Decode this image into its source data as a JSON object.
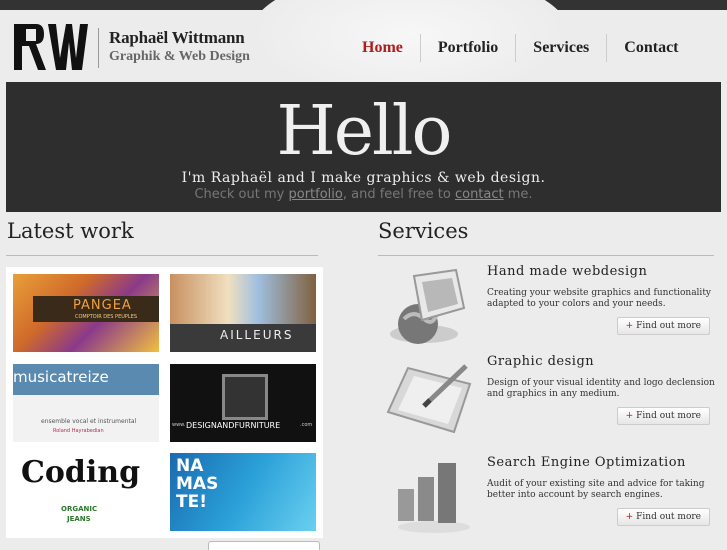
{
  "brand": {
    "name": "Raphaël Wittmann",
    "tagline": "Graphik & Web Design",
    "logo_icon": "rw-monogram-logo"
  },
  "nav": {
    "items": [
      {
        "label": "Home",
        "active": true
      },
      {
        "label": "Portfolio",
        "active": false
      },
      {
        "label": "Services",
        "active": false
      },
      {
        "label": "Contact",
        "active": false
      }
    ]
  },
  "hero": {
    "title": "Hello",
    "line1": "I'm Raphaël and I make graphics & web design.",
    "line2_pre": "Check out my ",
    "line2_link1": "portfolio",
    "line2_mid": ", and feel free to ",
    "line2_link2": "contact",
    "line2_post": " me."
  },
  "latest_work": {
    "title": "Latest work",
    "items": [
      {
        "caption": "PANGEA",
        "sub": "COMPTOIR DES PEUPLES"
      },
      {
        "caption": "AILLEURS",
        "sub": ""
      },
      {
        "caption": "musicatreize",
        "sub": "ensemble vocal et instrumental",
        "sub2": "Roland Hayrabedian"
      },
      {
        "caption": "DESIGNANDFURNITURE",
        "sub": ".com",
        "prefix": "www."
      },
      {
        "caption": "Coding",
        "sub": "ORGANIC",
        "sub2": "JEANS"
      },
      {
        "caption": "NA MAS TE!",
        "sub": ""
      }
    ]
  },
  "services": {
    "title": "Services",
    "items": [
      {
        "title": "Hand made webdesign",
        "text": "Creating your website graphics and functionality adapted to your colors and your needs.",
        "button": "Find out more",
        "icon": "computer-globe-icon"
      },
      {
        "title": "Graphic design",
        "text": "Design of your visual identity and logo declension and graphics in any medium.",
        "button": "Find out more",
        "icon": "graphic-tablet-icon"
      },
      {
        "title": "Search Engine Optimization",
        "text": "Audit of your existing site and advice for taking better into account by search engines.",
        "button": "Find out more",
        "icon": "bar-chart-icon"
      }
    ]
  },
  "colors": {
    "accent": "#b31b1b",
    "hero_bg": "#2e2e2e",
    "page_bg": "#ececec"
  }
}
